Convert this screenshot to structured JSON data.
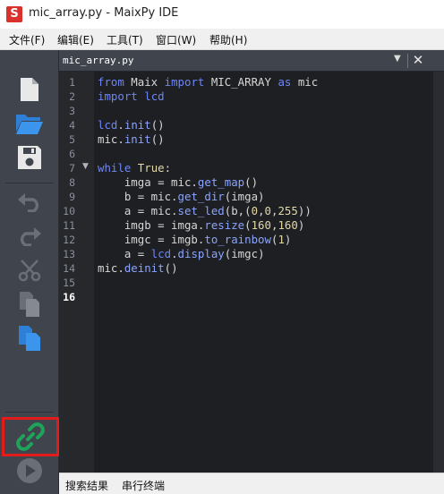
{
  "window": {
    "icon_letter": "S",
    "title": "mic_array.py - MaixPy IDE"
  },
  "menu": [
    {
      "label": "文件(F)"
    },
    {
      "label": "编辑(E)"
    },
    {
      "label": "工具(T)"
    },
    {
      "label": "窗口(W)"
    },
    {
      "label": "帮助(H)"
    }
  ],
  "toolbar": {
    "buttons": [
      {
        "name": "new-file",
        "icon": "file-icon",
        "enabled": true
      },
      {
        "name": "open-file",
        "icon": "folder-open-icon",
        "enabled": true
      },
      {
        "name": "save-file",
        "icon": "floppy-disk-icon",
        "enabled": true
      },
      {
        "name": "undo",
        "icon": "undo-icon",
        "enabled": false
      },
      {
        "name": "redo",
        "icon": "redo-icon",
        "enabled": false
      },
      {
        "name": "cut",
        "icon": "scissors-icon",
        "enabled": false
      },
      {
        "name": "copy",
        "icon": "copy-icon",
        "enabled": false
      },
      {
        "name": "paste",
        "icon": "paste-icon",
        "enabled": true
      },
      {
        "name": "connect",
        "icon": "link-icon",
        "enabled": true,
        "highlighted": true
      },
      {
        "name": "run",
        "icon": "play-icon",
        "enabled": false
      }
    ],
    "colors": {
      "active_icon": "#e8e8e8",
      "accent_blue": "#2e7fd6",
      "connect_green": "#1fa35b",
      "highlight_red": "#e31b1b"
    }
  },
  "editor": {
    "tab_label": "mic_array.py",
    "current_line": 16,
    "line_numbers": [
      "1",
      "2",
      "3",
      "4",
      "5",
      "6",
      "7",
      "8",
      "9",
      "10",
      "11",
      "12",
      "13",
      "14",
      "15",
      "16"
    ],
    "code": [
      "from Maix import MIC_ARRAY as mic",
      "import lcd",
      "",
      "lcd.init()",
      "mic.init()",
      "",
      "while True:",
      "    imga = mic.get_map()",
      "    b = mic.get_dir(imga)",
      "    a = mic.set_led(b,(0,0,255))",
      "    imgb = imga.resize(160,160)",
      "    imgc = imgb.to_rainbow(1)",
      "    a = lcd.display(imgc)",
      "mic.deinit()",
      "",
      ""
    ]
  },
  "bottom_tabs": [
    {
      "label": "搜索结果"
    },
    {
      "label": "串行终端"
    }
  ]
}
